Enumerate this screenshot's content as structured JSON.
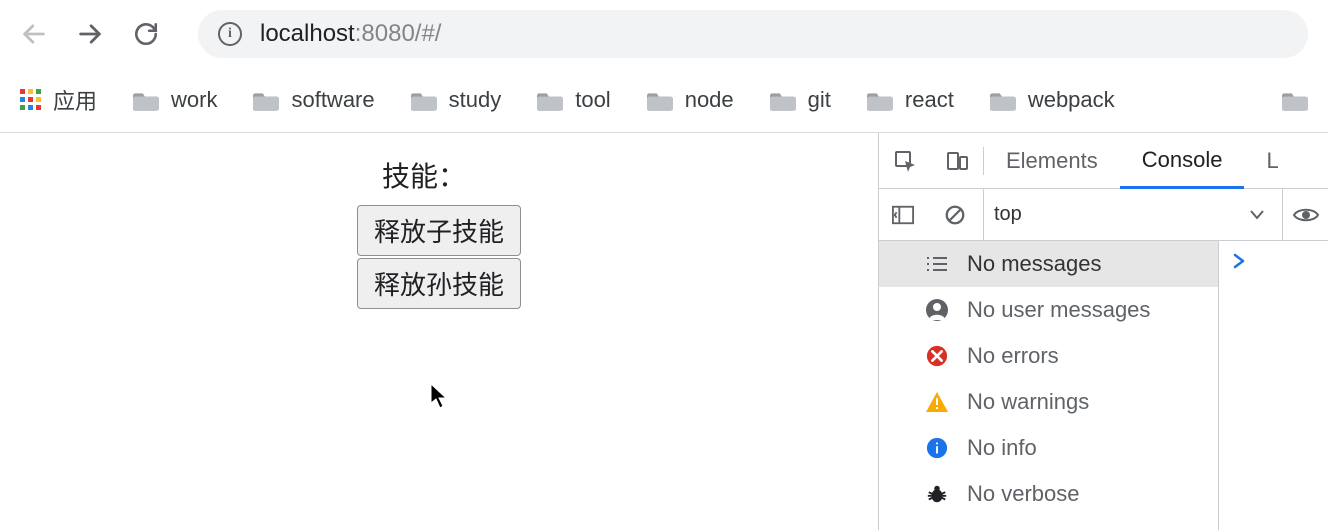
{
  "nav": {
    "url_main": "localhost",
    "url_rest": ":8080/#/"
  },
  "bookmarks": {
    "apps_label": "应用",
    "items": [
      {
        "label": "work"
      },
      {
        "label": "software"
      },
      {
        "label": "study"
      },
      {
        "label": "tool"
      },
      {
        "label": "node"
      },
      {
        "label": "git"
      },
      {
        "label": "react"
      },
      {
        "label": "webpack"
      }
    ]
  },
  "page": {
    "title": "技能：",
    "btn1": "释放子技能",
    "btn2": "释放孙技能"
  },
  "devtools": {
    "tabs": {
      "elements": "Elements",
      "console": "Console",
      "extra": "L"
    },
    "context": "top",
    "sidebar": [
      {
        "label": "No messages"
      },
      {
        "label": "No user messages"
      },
      {
        "label": "No errors"
      },
      {
        "label": "No warnings"
      },
      {
        "label": "No info"
      },
      {
        "label": "No verbose"
      }
    ]
  }
}
